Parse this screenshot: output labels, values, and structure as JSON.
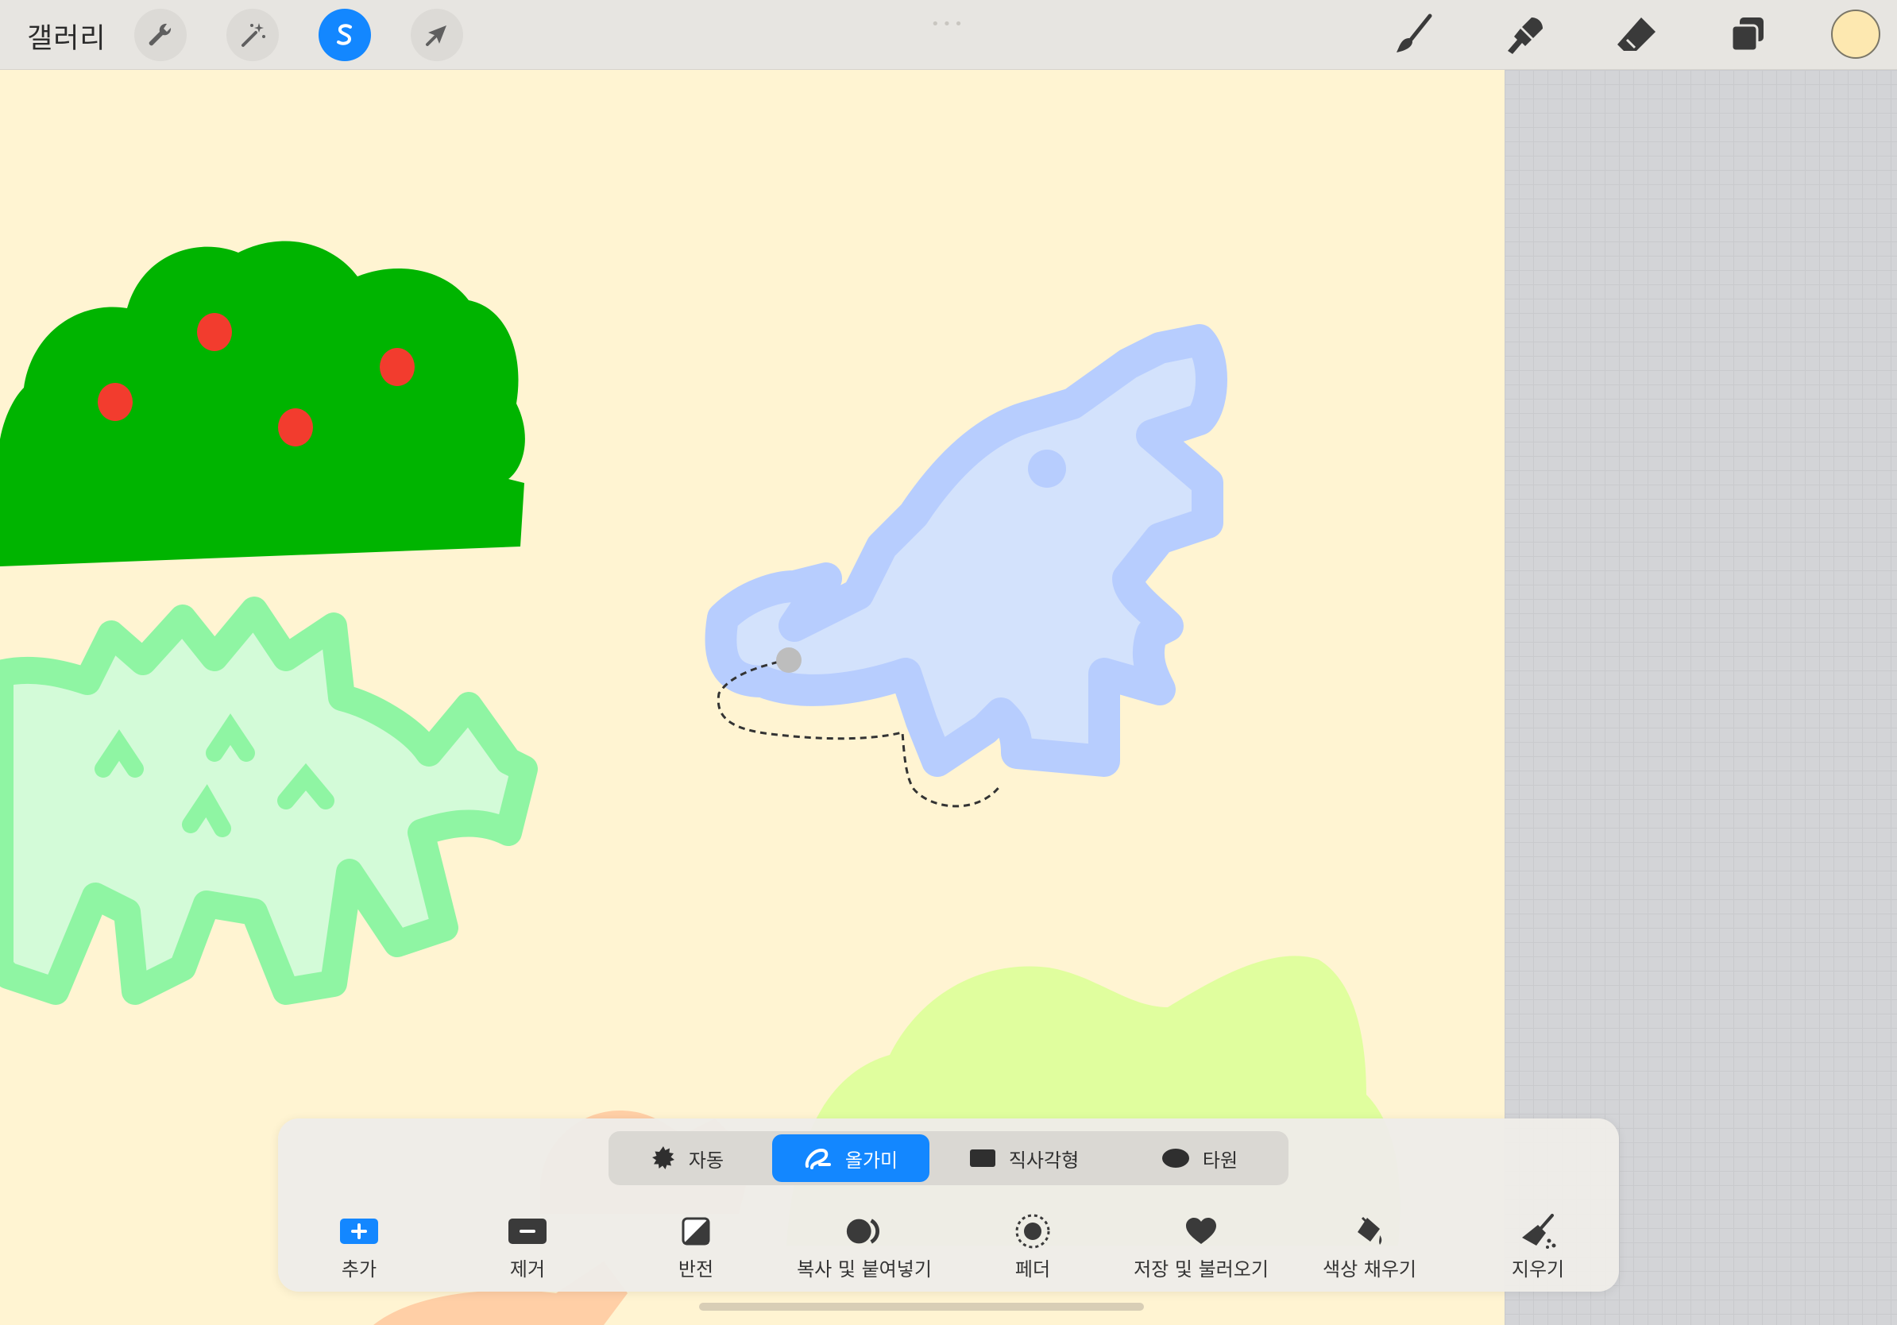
{
  "toolbar": {
    "gallery_label": "갤러리",
    "left_tools": [
      {
        "name": "actions",
        "icon": "wrench-icon"
      },
      {
        "name": "adjustments",
        "icon": "magic-wand-icon"
      },
      {
        "name": "selection",
        "icon": "selection-s-icon",
        "active": true
      },
      {
        "name": "transform",
        "icon": "arrow-cursor-icon"
      }
    ],
    "right_tools": [
      {
        "name": "paint",
        "icon": "brush-icon"
      },
      {
        "name": "smudge",
        "icon": "smudge-icon"
      },
      {
        "name": "erase",
        "icon": "eraser-icon"
      },
      {
        "name": "layers",
        "icon": "layers-icon"
      }
    ],
    "current_color": "#fde8b0",
    "accent": "#1387ff"
  },
  "selection_modes": [
    {
      "label": "자동",
      "icon": "auto-select-icon",
      "selected": false
    },
    {
      "label": "올가미",
      "icon": "lasso-icon",
      "selected": true
    },
    {
      "label": "직사각형",
      "icon": "rectangle-icon",
      "selected": false
    },
    {
      "label": "타원",
      "icon": "ellipse-icon",
      "selected": false
    }
  ],
  "selection_actions": [
    {
      "label": "추가",
      "icon": "add-icon"
    },
    {
      "label": "제거",
      "icon": "remove-icon"
    },
    {
      "label": "반전",
      "icon": "invert-icon"
    },
    {
      "label": "복사 및 붙여넣기",
      "icon": "copy-paste-icon"
    },
    {
      "label": "페더",
      "icon": "feather-icon"
    },
    {
      "label": "저장 및 불러오기",
      "icon": "heart-icon"
    },
    {
      "label": "색상 채우기",
      "icon": "fill-bucket-icon"
    },
    {
      "label": "지우기",
      "icon": "clear-broom-icon"
    }
  ],
  "canvas": {
    "background": "#fff4d2",
    "artwork": [
      "green-bush-with-red-berries",
      "green-stegosaurus",
      "blue-dinosaur",
      "lime-bush",
      "orange-dinosaur"
    ]
  }
}
